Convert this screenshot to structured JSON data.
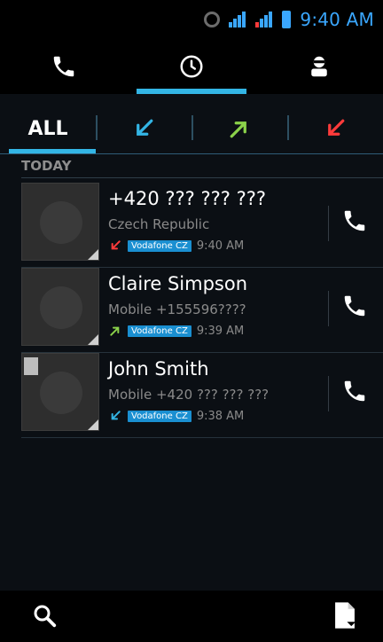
{
  "status_bar": {
    "time": "9:40 AM"
  },
  "tabs": [
    {
      "name": "phone",
      "icon": "phone-icon"
    },
    {
      "name": "call-log",
      "icon": "clock-icon"
    },
    {
      "name": "contacts",
      "icon": "person-icon"
    }
  ],
  "filters": {
    "all_label": "ALL",
    "icons": [
      "incoming-arrow-icon",
      "outgoing-arrow-icon",
      "missed-arrow-icon"
    ]
  },
  "section": {
    "label": "TODAY"
  },
  "calls": [
    {
      "name": "+420 ??? ??? ???",
      "sub": "Czech Republic",
      "carrier": "Vodafone CZ",
      "time": "9:40 AM",
      "type": "missed",
      "arrow_color": "#ff3b3b"
    },
    {
      "name": "Claire Simpson",
      "sub": "Mobile +155596????",
      "carrier": "Vodafone CZ",
      "time": "9:39 AM",
      "type": "outgoing",
      "arrow_color": "#8bd24a"
    },
    {
      "name": "John Smith",
      "sub": "Mobile +420 ??? ??? ???",
      "carrier": "Vodafone CZ",
      "time": "9:38 AM",
      "type": "incoming",
      "arrow_color": "#33b5e5"
    }
  ],
  "colors": {
    "accent": "#33b5e5",
    "badge": "#1a8fd1"
  }
}
